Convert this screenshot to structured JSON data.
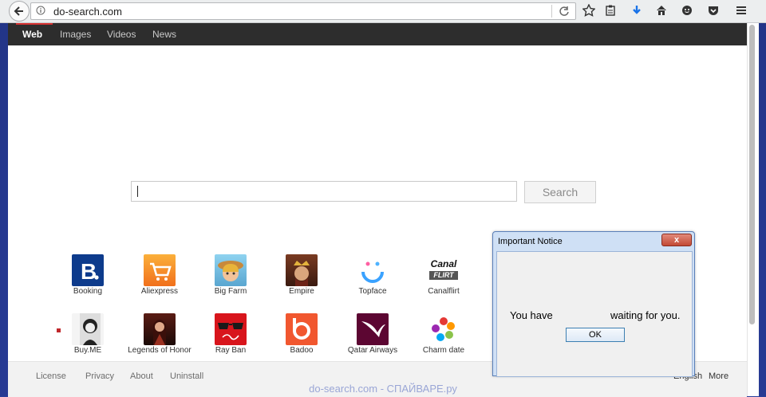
{
  "browser": {
    "url": "do-search.com"
  },
  "nav": {
    "items": [
      "Web",
      "Images",
      "Videos",
      "News"
    ]
  },
  "search": {
    "value": "",
    "button_label": "Search"
  },
  "tiles": [
    {
      "label": "Booking",
      "icon": "booking-icon"
    },
    {
      "label": "Aliexpress",
      "icon": "aliexpress-icon"
    },
    {
      "label": "Big Farm",
      "icon": "big-farm-icon"
    },
    {
      "label": "Empire",
      "icon": "empire-icon"
    },
    {
      "label": "Topface",
      "icon": "topface-icon"
    },
    {
      "label": "Canalflirt",
      "icon": "canalflirt-icon",
      "logo_text1": "Canal",
      "logo_text2": "FLIRT"
    },
    {
      "label": "Buy.ME",
      "icon": "buyme-icon"
    },
    {
      "label": "Legends of Honor",
      "icon": "legends-of-honor-icon"
    },
    {
      "label": "Ray Ban",
      "icon": "ray-ban-icon"
    },
    {
      "label": "Badoo",
      "icon": "badoo-icon"
    },
    {
      "label": "Qatar Airways",
      "icon": "qatar-airways-icon"
    },
    {
      "label": "Charm date",
      "icon": "charm-date-icon"
    }
  ],
  "footer": {
    "links": [
      "License",
      "Privacy",
      "About",
      "Uninstall"
    ],
    "language": "English",
    "more": "More"
  },
  "dialog": {
    "title": "Important Notice",
    "close": "x",
    "text_part1": "You have",
    "text_part2": "waiting for you.",
    "ok_label": "OK"
  },
  "watermark": "do-search.com - СПАЙВАРЕ.ру",
  "colors": {
    "nav_bg": "#2d2d2d",
    "nav_active_bar": "#d63131",
    "desktop_bg": "#2a3f9b"
  }
}
